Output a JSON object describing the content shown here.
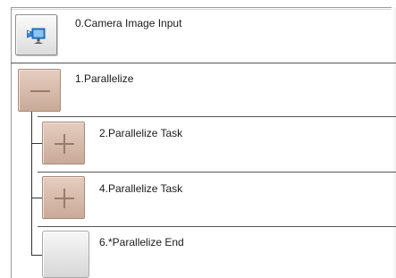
{
  "flow": {
    "items": [
      {
        "label": "0.Camera Image Input",
        "icon": "camera-icon"
      },
      {
        "label": "1.Parallelize",
        "state": "expanded",
        "icon": "minus-icon"
      },
      {
        "label": "2.Parallelize Task",
        "state": "collapsed",
        "icon": "plus-icon"
      },
      {
        "label": "4.Parallelize Task",
        "state": "collapsed",
        "icon": "plus-icon"
      },
      {
        "label": "6.*Parallelize End"
      }
    ]
  },
  "colors": {
    "expand_button": "#d8bcae",
    "separator": "#555555",
    "tree_line": "#333333",
    "camera_blue": "#2a7fd4"
  }
}
